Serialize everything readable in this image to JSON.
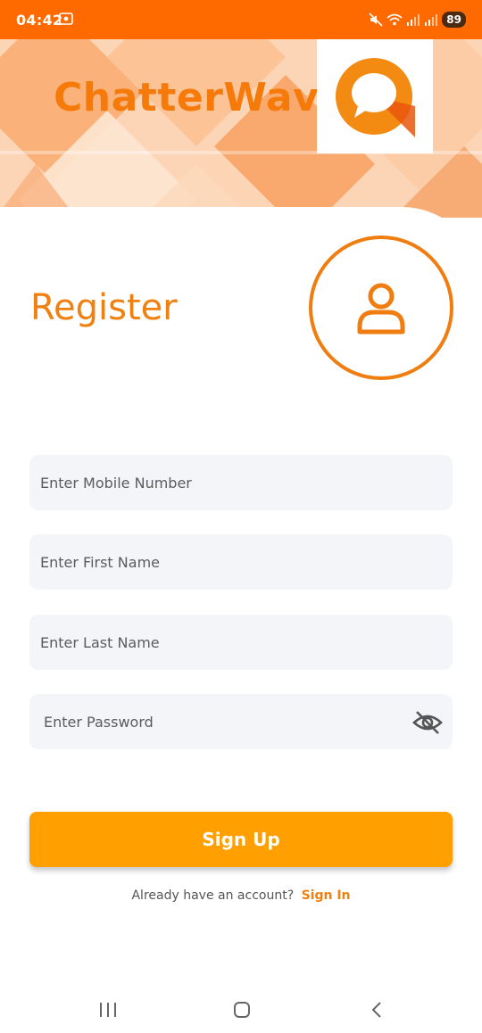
{
  "status_bar": {
    "time": "04:42",
    "battery": "89"
  },
  "app": {
    "brand_name": "ChatterWave",
    "accent_color": "#f57a0a",
    "header_bg_color": "#fcd9bd",
    "button_color": "#ffa000"
  },
  "register": {
    "title": "Register",
    "avatar_icon": "user-icon"
  },
  "form": {
    "mobile": {
      "placeholder": "Enter Mobile Number",
      "value": ""
    },
    "first_name": {
      "placeholder": "Enter First Name",
      "value": ""
    },
    "last_name": {
      "placeholder": "Enter Last Name",
      "value": ""
    },
    "password": {
      "placeholder": "Enter Password",
      "value": "",
      "toggle_icon": "eye-off-icon"
    },
    "submit_label": "Sign Up"
  },
  "footer": {
    "prompt": "Already have an account?",
    "link_label": "Sign In"
  },
  "nav": {
    "items": [
      "recent-apps-icon",
      "home-icon",
      "back-icon"
    ]
  }
}
